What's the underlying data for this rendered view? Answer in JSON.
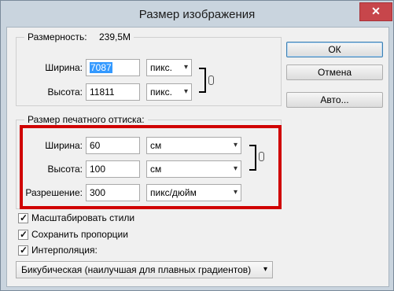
{
  "window": {
    "title": "Размер изображения",
    "close_glyph": "✕"
  },
  "pixel_dimensions": {
    "label": "Размерность:",
    "value": "239,5M",
    "width_label": "Ширина:",
    "width_value": "7087",
    "width_unit": "пикс.",
    "height_label": "Высота:",
    "height_value": "11811",
    "height_unit": "пикс."
  },
  "document_size": {
    "label": "Размер печатного оттиска:",
    "width_label": "Ширина:",
    "width_value": "60",
    "width_unit": "см",
    "height_label": "Высота:",
    "height_value": "100",
    "height_unit": "см",
    "resolution_label": "Разрешение:",
    "resolution_value": "300",
    "resolution_unit": "пикс/дюйм"
  },
  "buttons": {
    "ok": "ОК",
    "cancel": "Отмена",
    "auto": "Авто..."
  },
  "options": {
    "scale_styles": "Масштабировать стили",
    "constrain": "Сохранить пропорции",
    "resample": "Интерполяция:",
    "resample_method": "Бикубическая (наилучшая для плавных градиентов)",
    "checked_glyph": "✓"
  },
  "icons": {
    "dropdown": "▾"
  },
  "colors": {
    "highlight": "#d00000",
    "selection": "#3399ff",
    "close": "#c7464b"
  }
}
